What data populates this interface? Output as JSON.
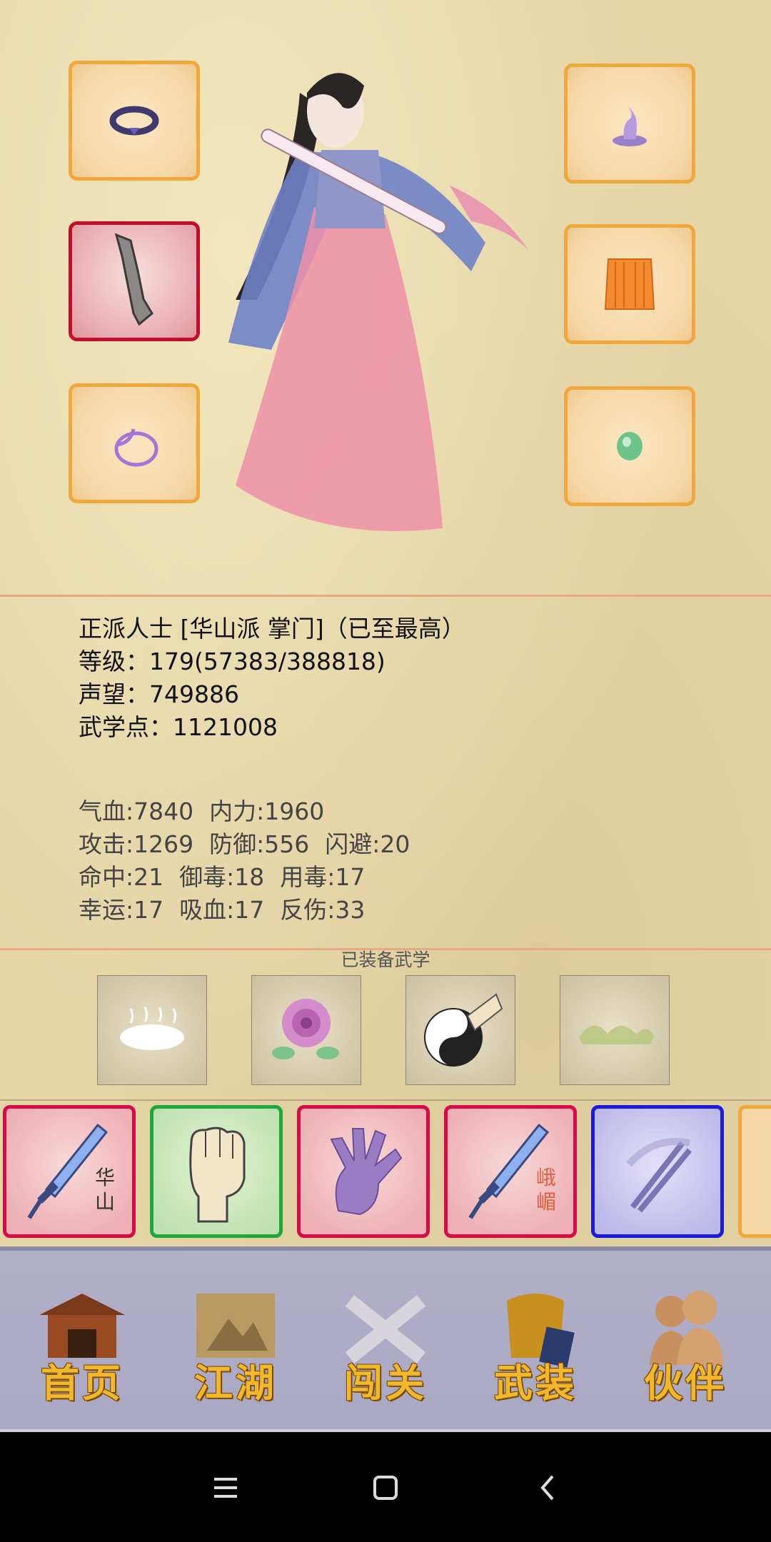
{
  "character": {
    "title": "正派人士 [华山派 掌门]（已至最高）",
    "level": "等级：179(57383/388818)",
    "prestige": "声望：749886",
    "martial_points": "武学点：1121008"
  },
  "stats": {
    "row1": [
      "气血:7840",
      "内力:1960"
    ],
    "row2": [
      "攻击:1269",
      "防御:556",
      "闪避:20"
    ],
    "row3": [
      "命中:21",
      "御毒:18",
      "用毒:17"
    ],
    "row4": [
      "幸运:17",
      "吸血:17",
      "反伤:33"
    ]
  },
  "equipped_section": {
    "title": "已装备武学"
  },
  "skill_cards": [
    {
      "icon": "sword-icon",
      "label_1": "华",
      "label_2": "山",
      "frame": "red"
    },
    {
      "icon": "fist-icon",
      "frame": "green"
    },
    {
      "icon": "palm-icon",
      "frame": "red"
    },
    {
      "icon": "sword-icon",
      "label_1": "峨",
      "label_2": "嵋",
      "frame": "red"
    },
    {
      "icon": "twin-blades-icon",
      "frame": "blue"
    },
    {
      "icon": "partial-card",
      "frame": "gold"
    }
  ],
  "nav": {
    "home": "首页",
    "jianghu": "江湖",
    "challenge": "闯关",
    "equipment": "武装",
    "partner": "伙伴"
  },
  "colors": {
    "slot_border": "#f0a83c",
    "selected_border": "#c40c2c",
    "nav_gold": "#f0b82a"
  }
}
